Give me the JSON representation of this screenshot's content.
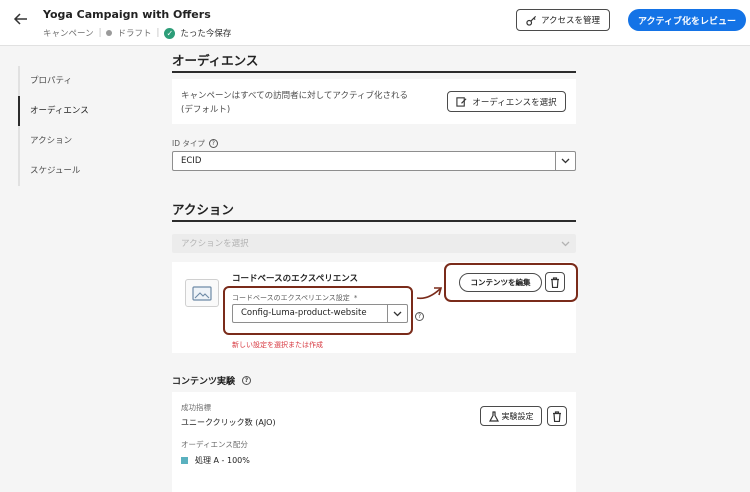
{
  "header": {
    "title": "Yoga Campaign with Offers",
    "meta": {
      "type": "キャンペーン",
      "status": "ドラフト",
      "saved": "たった今保存"
    },
    "access_button": "アクセスを管理",
    "review_button": "アクティブ化をレビュー"
  },
  "sidebar": {
    "items": [
      {
        "label": "プロパティ"
      },
      {
        "label": "オーディエンス"
      },
      {
        "label": "アクション"
      },
      {
        "label": "スケジュール"
      }
    ]
  },
  "audience": {
    "title": "オーディエンス",
    "description_line1": "キャンペーンはすべての訪問者に対してアクティブ化される",
    "description_line2": "(デフォルト)",
    "select_button": "オーディエンスを選択",
    "id_type_label": "ID タイプ",
    "id_type_value": "ECID"
  },
  "action": {
    "title": "アクション",
    "select_placeholder": "アクションを選択",
    "code_based": {
      "title": "コードベースのエクスペリエンス",
      "config_label": "コードベースのエクスペリエンス設定",
      "required_mark": "*",
      "config_value": "Config-Luma-product-website",
      "error_text": "新しい設定を選択または作成",
      "edit_button": "コンテンツを編集"
    }
  },
  "experiment": {
    "title": "コンテンツ実験",
    "metric_label": "成功指標",
    "metric_value": "ユニーククリック数 (AJO)",
    "button": "実験設定",
    "distribution_label": "オーディエンス配分",
    "treatment_value": "処理 A - 100%"
  },
  "colors": {
    "accent": "#1473e6",
    "annotation": "#7a2b1a",
    "error": "#d7373f",
    "success": "#2d9d78",
    "treatment": "#5ab1bf"
  },
  "icons": [
    "back-arrow-icon",
    "check-circle-icon",
    "key-icon",
    "audience-edit-icon",
    "help-icon",
    "chevron-down-icon",
    "image-icon",
    "trash-icon",
    "flask-icon"
  ]
}
